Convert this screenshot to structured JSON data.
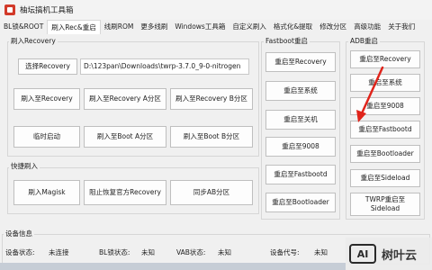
{
  "window": {
    "title": "柚坛搞机工具箱"
  },
  "menu": [
    "BL锁&ROOT",
    "刷入Rec&重启",
    "线刷ROM",
    "更多线刷",
    "Windows工具箱",
    "自定义刷入",
    "格式化&提取",
    "修改分区",
    "高级功能",
    "关于我们"
  ],
  "recovery_section": {
    "label": "刷入Recovery",
    "select_button": "选择Recovery",
    "path_value": "D:\\123pan\\Downloads\\twrp-3.7.0_9-0-nitrogen",
    "buttons": [
      "刷入至Recovery",
      "刷入至Recovery A分区",
      "刷入至Recovery B分区",
      "临时启动",
      "刷入至Boot A分区",
      "刷入至Boot B分区"
    ]
  },
  "quick_section": {
    "label": "快捷刷入",
    "buttons": [
      "刷入Magisk",
      "阻止恢复官方Recovery",
      "同步AB分区"
    ]
  },
  "fastboot_section": {
    "label": "Fastboot重启",
    "buttons": [
      "重启至Recovery",
      "重启至系统",
      "重启至关机",
      "重启至9008",
      "重启至Fastbootd",
      "重启至Bootloader"
    ]
  },
  "adb_section": {
    "label": "ADB重启",
    "buttons": [
      "重启至Recovery",
      "重启至系统",
      "重启至9008",
      "重启至Fastbootd",
      "重启至Bootloader",
      "重启至Sideload",
      "TWRP重启至\nSideload"
    ]
  },
  "device_info": {
    "label": "设备信息",
    "device_status_label": "设备状态:",
    "device_status_value": "未连接",
    "bl_status_label": "BL锁状态:",
    "bl_status_value": "未知",
    "vab_status_label": "VAB状态:",
    "vab_status_value": "未知",
    "device_code_label": "设备代号:",
    "device_code_value": "未知"
  },
  "watermark": {
    "logo": "AI",
    "text": "树叶云"
  },
  "colors": {
    "arrow": "#e0241b",
    "accent": "#d23a2a"
  }
}
